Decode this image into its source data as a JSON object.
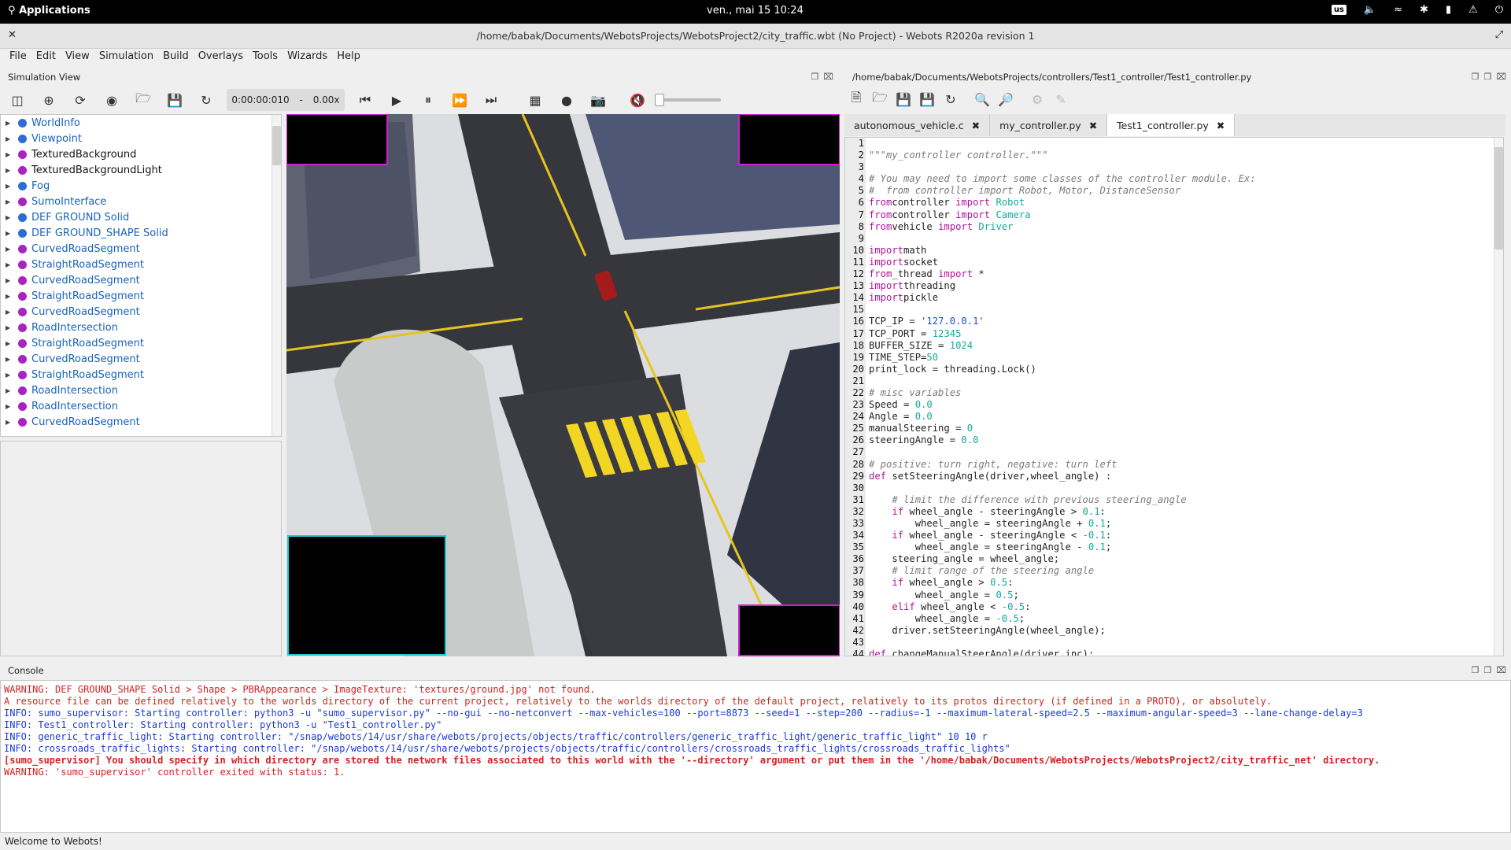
{
  "topbar": {
    "apps": "Applications",
    "datetime": "ven., mai 15  10:24",
    "keyboard": "us"
  },
  "window": {
    "title": "/home/babak/Documents/WebotsProjects/WebotsProject2/city_traffic.wbt (No Project) - Webots R2020a revision 1"
  },
  "menu": [
    "File",
    "Edit",
    "View",
    "Simulation",
    "Build",
    "Overlays",
    "Tools",
    "Wizards",
    "Help"
  ],
  "simview": {
    "title": "Simulation View",
    "time": "0:00:00:010",
    "sep": "-",
    "speed": "0.00x"
  },
  "scene_tree": [
    {
      "label": "WorldInfo",
      "color": "blue"
    },
    {
      "label": "Viewpoint",
      "color": "blue"
    },
    {
      "label": "TexturedBackground",
      "color": "purple",
      "black": true
    },
    {
      "label": "TexturedBackgroundLight",
      "color": "purple",
      "black": true
    },
    {
      "label": "Fog",
      "color": "blue"
    },
    {
      "label": "SumoInterface",
      "color": "purple"
    },
    {
      "label": "DEF GROUND Solid",
      "color": "blue"
    },
    {
      "label": "DEF GROUND_SHAPE Solid",
      "color": "blue"
    },
    {
      "label": "CurvedRoadSegment",
      "color": "purple"
    },
    {
      "label": "StraightRoadSegment",
      "color": "purple"
    },
    {
      "label": "CurvedRoadSegment",
      "color": "purple"
    },
    {
      "label": "StraightRoadSegment",
      "color": "purple"
    },
    {
      "label": "CurvedRoadSegment",
      "color": "purple"
    },
    {
      "label": "RoadIntersection",
      "color": "purple"
    },
    {
      "label": "StraightRoadSegment",
      "color": "purple"
    },
    {
      "label": "CurvedRoadSegment",
      "color": "purple"
    },
    {
      "label": "StraightRoadSegment",
      "color": "purple"
    },
    {
      "label": "RoadIntersection",
      "color": "purple"
    },
    {
      "label": "RoadIntersection",
      "color": "purple"
    },
    {
      "label": "CurvedRoadSegment",
      "color": "purple"
    }
  ],
  "editor": {
    "path": "/home/babak/Documents/WebotsProjects/controllers/Test1_controller/Test1_controller.py",
    "tabs": [
      "autonomous_vehicle.c",
      "my_controller.py",
      "Test1_controller.py"
    ],
    "active_tab": 2
  },
  "code_lines": [
    [],
    [
      [
        "cm",
        "\"\"\"my_controller controller.\"\"\""
      ]
    ],
    [],
    [
      [
        "cm",
        "# You may need to import some classes of the controller module. Ex:"
      ]
    ],
    [
      [
        "cm",
        "#  from controller import Robot, Motor, DistanceSensor"
      ]
    ],
    [
      [
        "kw",
        "from"
      ],
      [
        "",
        "controller "
      ],
      [
        "kw",
        "import"
      ],
      [
        "nm",
        " Robot"
      ]
    ],
    [
      [
        "kw",
        "from"
      ],
      [
        "",
        "controller "
      ],
      [
        "kw",
        "import"
      ],
      [
        "nm",
        " Camera"
      ]
    ],
    [
      [
        "kw",
        "from"
      ],
      [
        "",
        "vehicle "
      ],
      [
        "kw",
        "import"
      ],
      [
        "nm",
        " Driver"
      ]
    ],
    [],
    [
      [
        "kw",
        "import"
      ],
      [
        "",
        "math"
      ]
    ],
    [
      [
        "kw",
        "import"
      ],
      [
        "",
        "socket"
      ]
    ],
    [
      [
        "kw",
        "from"
      ],
      [
        "",
        "_thread "
      ],
      [
        "kw",
        "import"
      ],
      [
        "",
        " *"
      ]
    ],
    [
      [
        "kw",
        "import"
      ],
      [
        "",
        "threading"
      ]
    ],
    [
      [
        "kw",
        "import"
      ],
      [
        "",
        "pickle"
      ]
    ],
    [],
    [
      [
        "",
        "TCP_IP = "
      ],
      [
        "st",
        "'127.0.0.1'"
      ]
    ],
    [
      [
        "",
        "TCP_PORT = "
      ],
      [
        "nm",
        "12345"
      ]
    ],
    [
      [
        "",
        "BUFFER_SIZE = "
      ],
      [
        "nm",
        "1024"
      ]
    ],
    [
      [
        "",
        "TIME_STEP="
      ],
      [
        "nm",
        "50"
      ]
    ],
    [
      [
        "",
        "print_lock = threading.Lock()"
      ]
    ],
    [],
    [
      [
        "cm",
        "# misc variables"
      ]
    ],
    [
      [
        "",
        "Speed = "
      ],
      [
        "nm",
        "0.0"
      ]
    ],
    [
      [
        "",
        "Angle = "
      ],
      [
        "nm",
        "0.0"
      ]
    ],
    [
      [
        "",
        "manualSteering = "
      ],
      [
        "nm",
        "0"
      ]
    ],
    [
      [
        "",
        "steeringAngle = "
      ],
      [
        "nm",
        "0.0"
      ]
    ],
    [],
    [
      [
        "cm",
        "# positive: turn right, negative: turn left"
      ]
    ],
    [
      [
        "kw",
        "def"
      ],
      [
        "",
        " setSteeringAngle(driver,wheel_angle) :"
      ]
    ],
    [],
    [
      [
        "",
        "    "
      ],
      [
        "cm",
        "# limit the difference with previous steering_angle"
      ]
    ],
    [
      [
        "",
        "    "
      ],
      [
        "kw",
        "if"
      ],
      [
        "",
        " wheel_angle - steeringAngle > "
      ],
      [
        "nm",
        "0.1"
      ],
      [
        "",
        ":"
      ]
    ],
    [
      [
        "",
        "        wheel_angle = steeringAngle + "
      ],
      [
        "nm",
        "0.1"
      ],
      [
        "",
        ";"
      ]
    ],
    [
      [
        "",
        "    "
      ],
      [
        "kw",
        "if"
      ],
      [
        "",
        " wheel_angle - steeringAngle < "
      ],
      [
        "nm",
        "-0.1"
      ],
      [
        "",
        ":"
      ]
    ],
    [
      [
        "",
        "        wheel_angle = steeringAngle - "
      ],
      [
        "nm",
        "0.1"
      ],
      [
        "",
        ";"
      ]
    ],
    [
      [
        "",
        "    steering_angle = wheel_angle;"
      ]
    ],
    [
      [
        "",
        "    "
      ],
      [
        "cm",
        "# limit range of the steering angle"
      ]
    ],
    [
      [
        "",
        "    "
      ],
      [
        "kw",
        "if"
      ],
      [
        "",
        " wheel_angle > "
      ],
      [
        "nm",
        "0.5"
      ],
      [
        "",
        ":"
      ]
    ],
    [
      [
        "",
        "        wheel_angle = "
      ],
      [
        "nm",
        "0.5"
      ],
      [
        "",
        ";"
      ]
    ],
    [
      [
        "",
        "    "
      ],
      [
        "kw",
        "elif"
      ],
      [
        "",
        " wheel_angle < "
      ],
      [
        "nm",
        "-0.5"
      ],
      [
        "",
        ":"
      ]
    ],
    [
      [
        "",
        "        wheel_angle = "
      ],
      [
        "nm",
        "-0.5"
      ],
      [
        "",
        ";"
      ]
    ],
    [
      [
        "",
        "    driver.setSteeringAngle(wheel_angle);"
      ]
    ],
    [],
    [
      [
        "kw",
        "def"
      ],
      [
        "",
        " changeManualSteerAngle(driver,inc):"
      ]
    ]
  ],
  "console": {
    "title": "Console",
    "lines": [
      {
        "type": "warn",
        "text": "WARNING: DEF GROUND_SHAPE Solid > Shape > PBRAppearance > ImageTexture: 'textures/ground.jpg' not found."
      },
      {
        "type": "warn",
        "text": "A resource file can be defined relatively to the worlds directory of the current project, relatively to the worlds directory of the default project, relatively to its protos directory (if defined in a PROTO), or absolutely."
      },
      {
        "type": "info",
        "text": "INFO: sumo_supervisor: Starting controller: python3 -u \"sumo_supervisor.py\" --no-gui --no-netconvert --max-vehicles=100 --port=8873 --seed=1 --step=200 --radius=-1 --maximum-lateral-speed=2.5 --maximum-angular-speed=3 --lane-change-delay=3"
      },
      {
        "type": "info",
        "text": "INFO: Test1_controller: Starting controller: python3 -u \"Test1_controller.py\""
      },
      {
        "type": "info",
        "text": "INFO: generic_traffic_light: Starting controller: \"/snap/webots/14/usr/share/webots/projects/objects/traffic/controllers/generic_traffic_light/generic_traffic_light\" 10 10 r"
      },
      {
        "type": "info",
        "text": "INFO: crossroads_traffic_lights: Starting controller: \"/snap/webots/14/usr/share/webots/projects/objects/traffic/controllers/crossroads_traffic_lights/crossroads_traffic_lights\""
      },
      {
        "type": "err",
        "text": "[sumo_supervisor] You should specify in which directory are stored the network files associated to this world with the '--directory' argument or put them in the '/home/babak/Documents/WebotsProjects/WebotsProject2/city_traffic_net' directory."
      },
      {
        "type": "warn",
        "text": "WARNING: 'sumo_supervisor' controller exited with status: 1."
      }
    ]
  },
  "status": "Welcome to Webots!"
}
